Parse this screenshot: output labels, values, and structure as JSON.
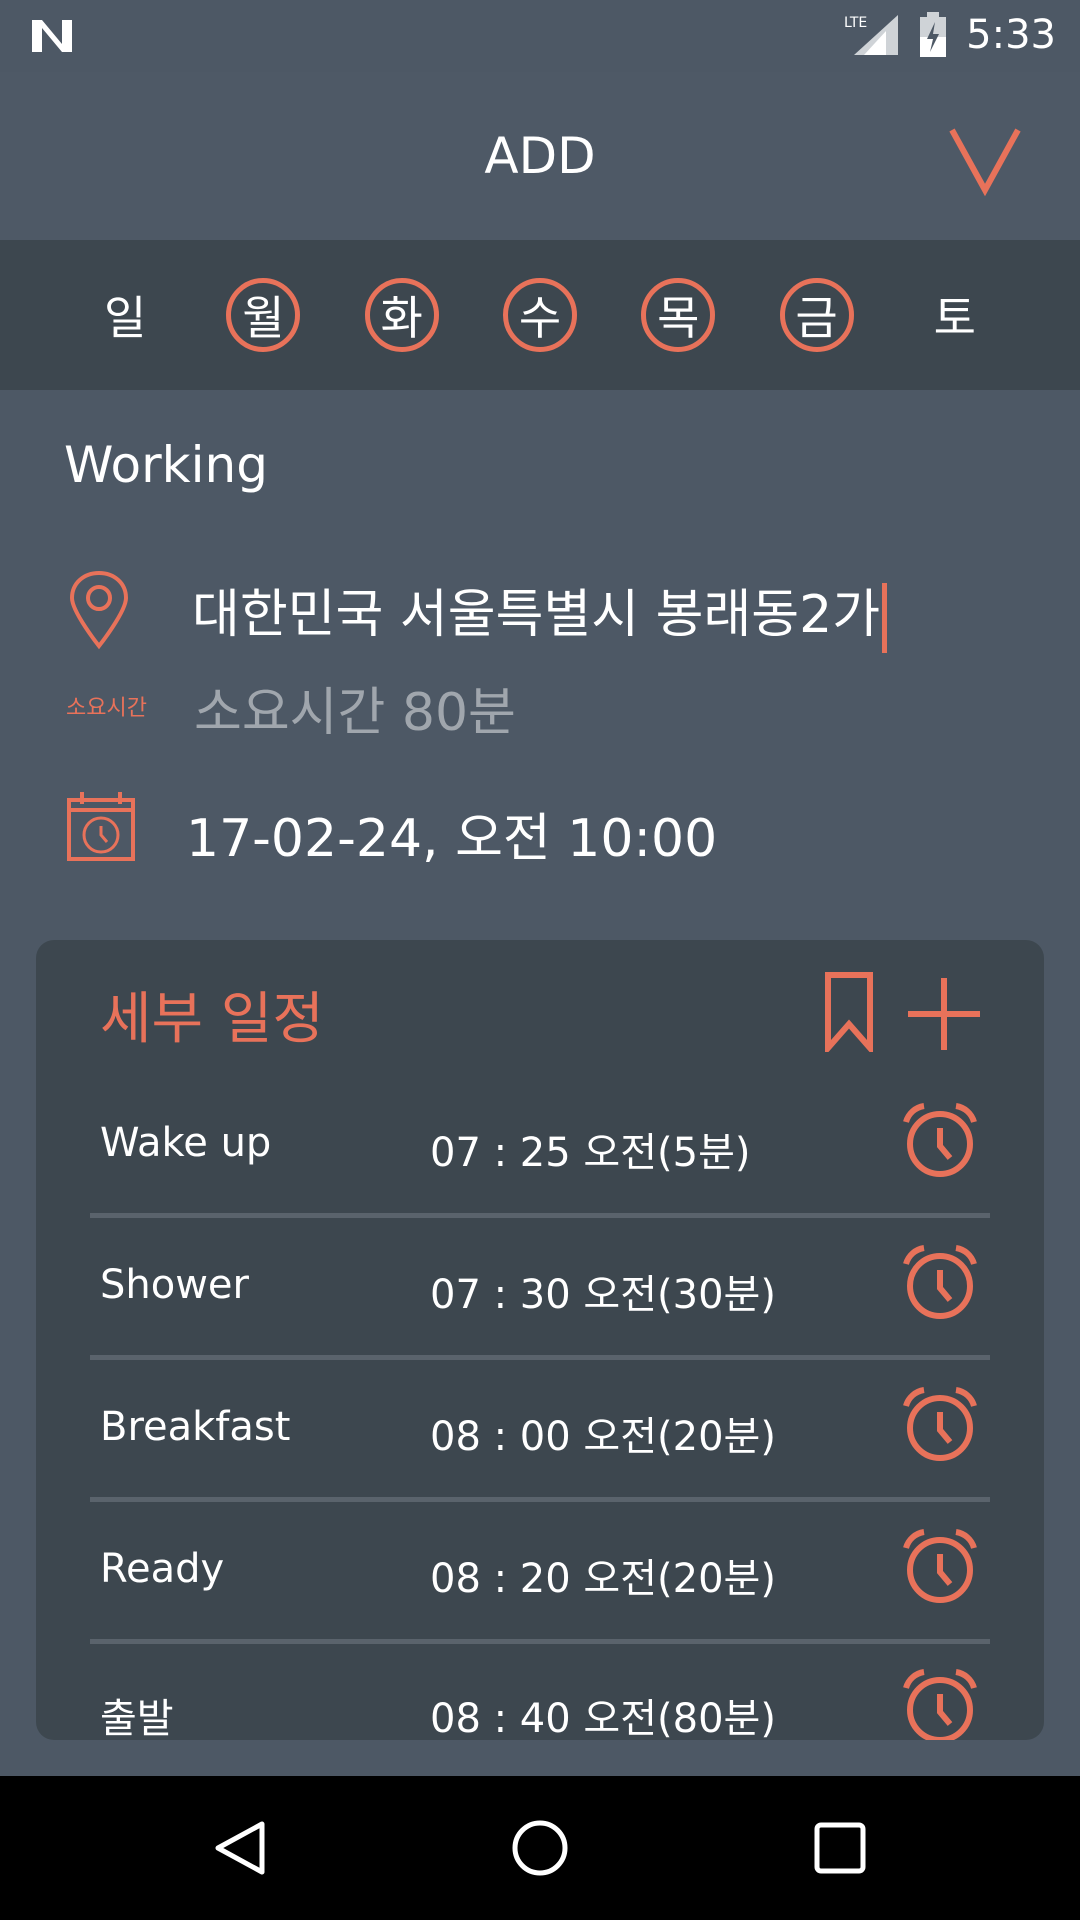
{
  "status_bar": {
    "network": "LTE",
    "time": "5:33",
    "icons": [
      "n-logo-icon",
      "signal-icon",
      "battery-charging-icon"
    ]
  },
  "header": {
    "title": "ADD",
    "confirm_icon": "check-icon"
  },
  "days": [
    {
      "label": "일",
      "selected": false
    },
    {
      "label": "월",
      "selected": true
    },
    {
      "label": "화",
      "selected": true
    },
    {
      "label": "수",
      "selected": true
    },
    {
      "label": "목",
      "selected": true
    },
    {
      "label": "금",
      "selected": true
    },
    {
      "label": "토",
      "selected": false
    }
  ],
  "task": {
    "name": "Working",
    "location": "대한민국 서울특별시 봉래동2가",
    "duration_label": "소요시간",
    "duration_value": "소요시간 80분",
    "datetime": "17-02-24, 오전 10:00"
  },
  "details": {
    "title": "세부 일정",
    "rows": [
      {
        "name": "Wake up",
        "time": "07 : 25 오전(5분)"
      },
      {
        "name": "Shower",
        "time": "07 : 30 오전(30분)"
      },
      {
        "name": "Breakfast",
        "time": "08 : 00 오전(20분)"
      },
      {
        "name": "Ready",
        "time": "08 : 20 오전(20분)"
      },
      {
        "name": "출발",
        "time": "08 : 40 오전(80분)"
      }
    ]
  },
  "colors": {
    "accent": "#e8725a",
    "background": "#4d5865",
    "panel": "#3d474f"
  }
}
